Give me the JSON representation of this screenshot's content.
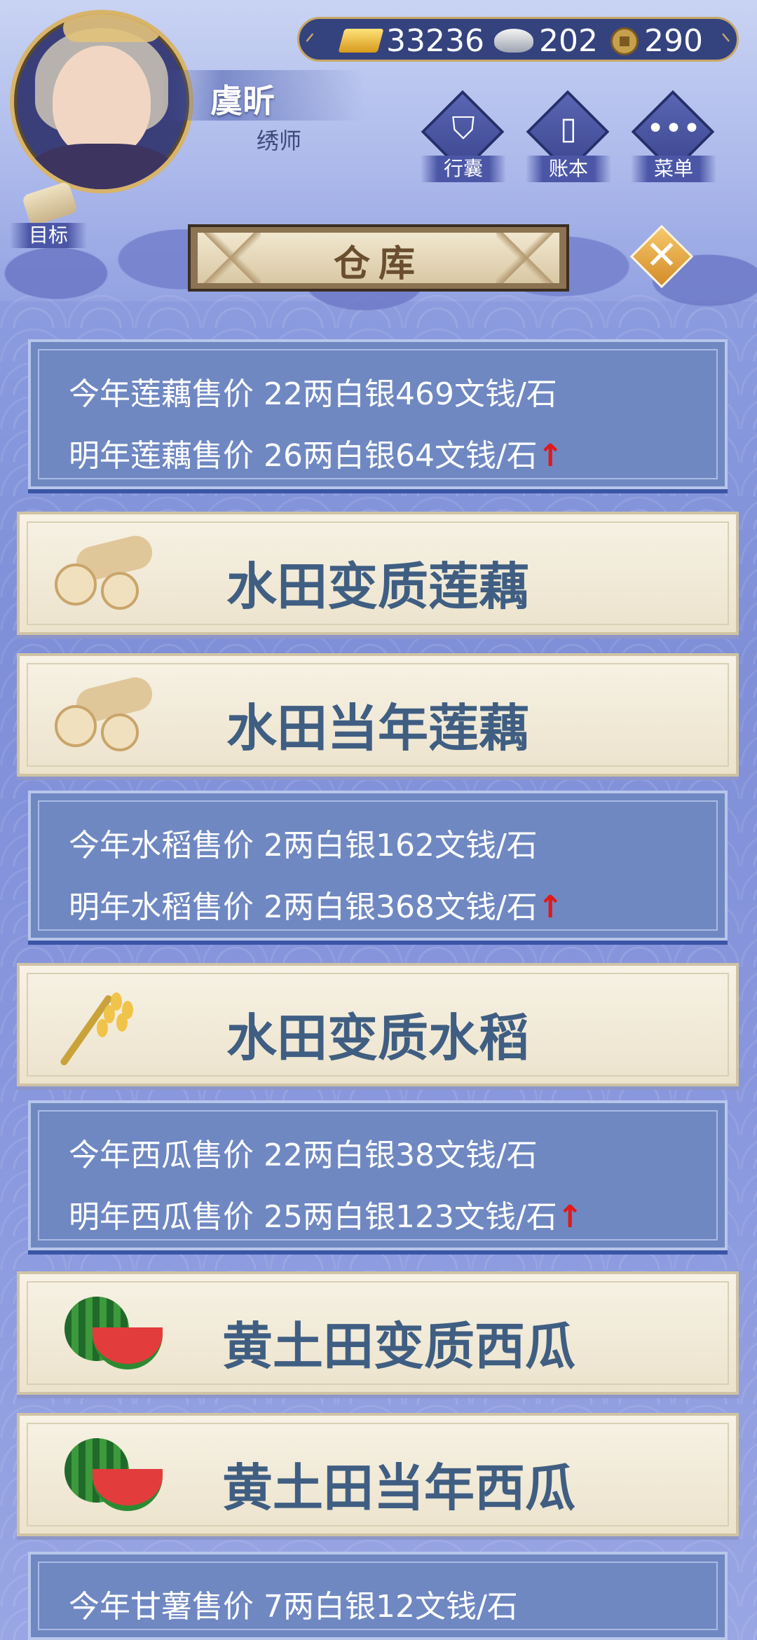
{
  "header": {
    "player_name": "虞昕",
    "player_title": "绣师",
    "gold": "33236",
    "silver": "202",
    "coins": "290",
    "buttons": [
      {
        "label": "行囊",
        "icon": "bag-icon"
      },
      {
        "label": "账本",
        "icon": "ledger-icon"
      },
      {
        "label": "菜单",
        "icon": "menu-dots-icon"
      }
    ],
    "goal_label": "目标"
  },
  "panel": {
    "title": "仓库"
  },
  "prices": [
    {
      "this_year": "今年莲藕售价 22两白银469文钱/石",
      "next_year": "明年莲藕售价 26两白银64文钱/石",
      "trend": "↑"
    },
    {
      "this_year": "今年水稻售价 2两白银162文钱/石",
      "next_year": "明年水稻售价 2两白银368文钱/石",
      "trend": "↑"
    },
    {
      "this_year": "今年西瓜售价 22两白银38文钱/石",
      "next_year": "明年西瓜售价 25两白银123文钱/石",
      "trend": "↑"
    },
    {
      "this_year": "今年甘薯售价 7两白银12文钱/石"
    }
  ],
  "items": [
    {
      "name": "水田变质莲藕",
      "icon": "lotus-root-icon"
    },
    {
      "name": "水田当年莲藕",
      "icon": "lotus-root-icon"
    },
    {
      "name": "水田变质水稻",
      "icon": "rice-icon"
    },
    {
      "name": "黄土田变质西瓜",
      "icon": "watermelon-icon"
    },
    {
      "name": "黄土田当年西瓜",
      "icon": "watermelon-icon"
    }
  ],
  "colors": {
    "trend_up": "#e11919",
    "item_text": "#3f5e82",
    "price_card": "#6f88c2"
  }
}
